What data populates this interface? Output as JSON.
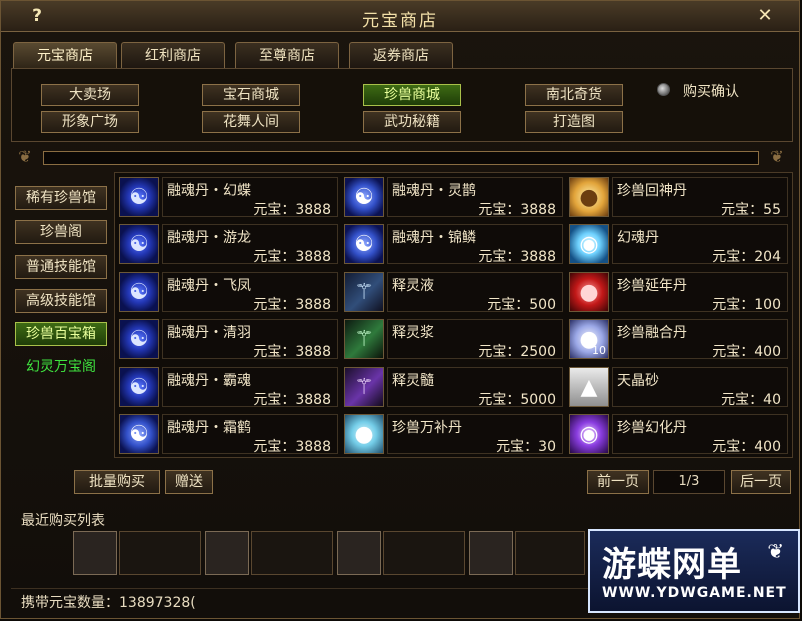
{
  "window": {
    "title": "元宝商店",
    "help": "?",
    "close": "✕"
  },
  "tabs": [
    "元宝商店",
    "红利商店",
    "至尊商店",
    "返券商店"
  ],
  "shops": [
    "大卖场",
    "宝石商城",
    "珍兽商城",
    "南北奇货",
    "形象广场",
    "花舞人间",
    "武功秘籍",
    "打造图"
  ],
  "active_shop": "珍兽商城",
  "buy_confirm_label": "购买确认",
  "categories": [
    "稀有珍兽馆",
    "珍兽阁",
    "普通技能馆",
    "高级技能馆",
    "珍兽百宝箱",
    "幻灵万宝阁"
  ],
  "active_category": "珍兽百宝箱",
  "price_prefix": "元宝：",
  "items": [
    {
      "name": "融魂丹・幻蝶",
      "price": "3888",
      "icon": "swirl-orb-icon"
    },
    {
      "name": "融魂丹・灵鹊",
      "price": "3888",
      "icon": "swirl-orb-icon"
    },
    {
      "name": "珍兽回神丹",
      "price": "55",
      "icon": "gold-pills-icon"
    },
    {
      "name": "融魂丹・游龙",
      "price": "3888",
      "icon": "swirl-orb-icon"
    },
    {
      "name": "融魂丹・锦鳞",
      "price": "3888",
      "icon": "swirl-orb-icon"
    },
    {
      "name": "幻魂丹",
      "price": "204",
      "icon": "crystal-orb-icon"
    },
    {
      "name": "融魂丹・飞凤",
      "price": "3888",
      "icon": "swirl-orb-icon"
    },
    {
      "name": "释灵液",
      "price": "500",
      "icon": "wand-icon"
    },
    {
      "name": "珍兽延年丹",
      "price": "100",
      "icon": "red-pills-icon"
    },
    {
      "name": "融魂丹・清羽",
      "price": "3888",
      "icon": "swirl-orb-icon"
    },
    {
      "name": "释灵浆",
      "price": "2500",
      "icon": "green-wand-icon"
    },
    {
      "name": "珍兽融合丹",
      "price": "400",
      "icon": "pearls-icon",
      "badge": "10"
    },
    {
      "name": "融魂丹・霸魂",
      "price": "3888",
      "icon": "swirl-orb-icon"
    },
    {
      "name": "释灵髓",
      "price": "5000",
      "icon": "purple-wand-icon"
    },
    {
      "name": "天晶砂",
      "price": "40",
      "icon": "sand-icon"
    },
    {
      "name": "融魂丹・霜鹤",
      "price": "3888",
      "icon": "swirl-orb-icon"
    },
    {
      "name": "珍兽万补丹",
      "price": "30",
      "icon": "blue-balls-icon"
    },
    {
      "name": "珍兽幻化丹",
      "price": "400",
      "icon": "purple-orb-icon"
    }
  ],
  "buttons": {
    "bulk_buy": "批量购买",
    "gift": "赠送",
    "prev": "前一页",
    "next": "后一页"
  },
  "page_indicator": "1/3",
  "recent_title": "最近购买列表",
  "carry_label": "携带元宝数量：",
  "carry_value": "13897328(",
  "watermark": {
    "title": "游蝶网单",
    "url": "WWW.YDWGAME.NET"
  }
}
